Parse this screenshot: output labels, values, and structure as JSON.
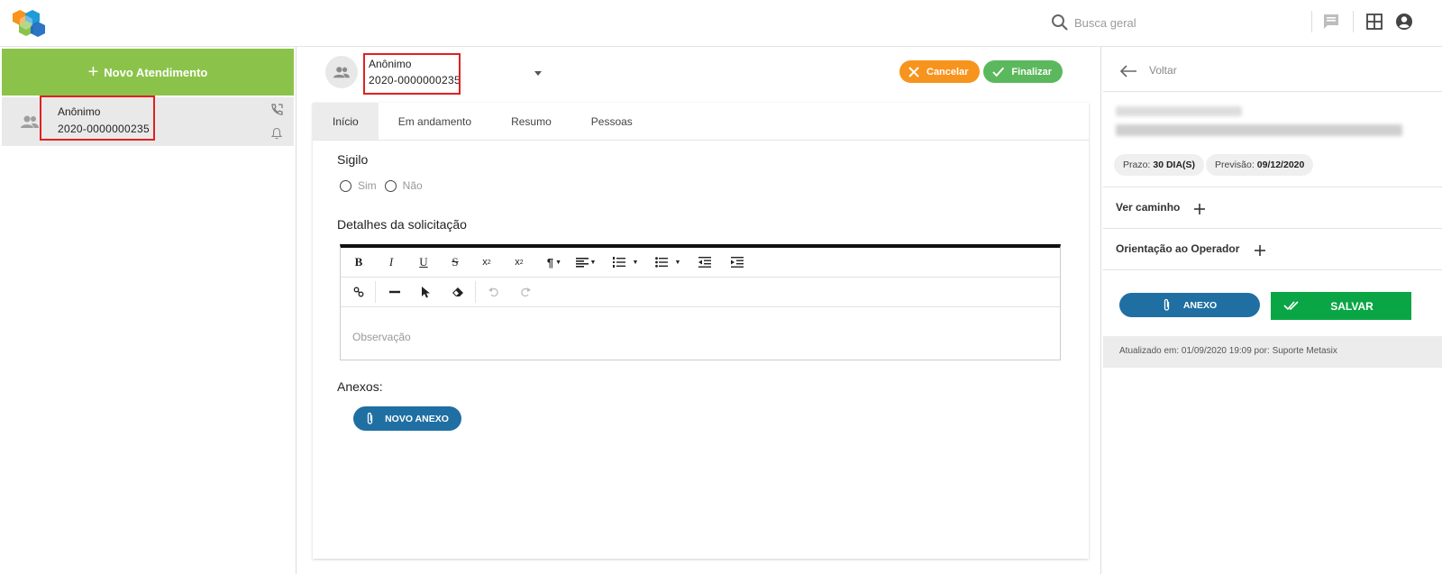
{
  "topbar": {
    "search_placeholder": "Busca geral",
    "icons": [
      "logo-icon",
      "search-icon",
      "chat-icon",
      "grid-icon",
      "account-icon"
    ]
  },
  "left": {
    "new_button_label": "Novo Atendimento",
    "call": {
      "name": "Anônimo",
      "protocol": "2020-0000000235"
    }
  },
  "center": {
    "header": {
      "name": "Anônimo",
      "protocol": "2020-0000000235"
    },
    "cancel_label": "Cancelar",
    "finish_label": "Finalizar",
    "tabs": [
      "Início",
      "Em andamento",
      "Resumo",
      "Pessoas"
    ],
    "active_tab": "Início",
    "sigilo_title": "Sigilo",
    "sigilo_options": [
      "Sim",
      "Não"
    ],
    "details_title": "Detalhes da solicitação",
    "editor_placeholder": "Observação",
    "toolbar": {
      "bold": "B",
      "italic": "I",
      "underline": "U",
      "strike": "S",
      "subscript": "x",
      "sub_mark": "2",
      "superscript": "x",
      "sup_mark": "2",
      "paragraph": "¶"
    },
    "anexos_title": "Anexos:",
    "novo_anexo_label": "NOVO ANEXO"
  },
  "right": {
    "back_label": "Voltar",
    "prazo_label": "Prazo:",
    "prazo_value": "30 DIA(S)",
    "previsao_label": "Previsão:",
    "previsao_value": "09/12/2020",
    "ver_caminho_label": "Ver caminho",
    "orientacao_label": "Orientação ao Operador",
    "anexo_label": "ANEXO",
    "salvar_label": "SALVAR",
    "updated_text": "Atualizado em: 01/09/2020 19:09 por: Suporte Metasix"
  },
  "colors": {
    "green_new": "#8bc34a",
    "orange_cancel": "#f7941d",
    "green_finish": "#5cb85c",
    "blue_button": "#1f6fa3",
    "green_save": "#0aa646",
    "highlight_red": "#e02020"
  }
}
